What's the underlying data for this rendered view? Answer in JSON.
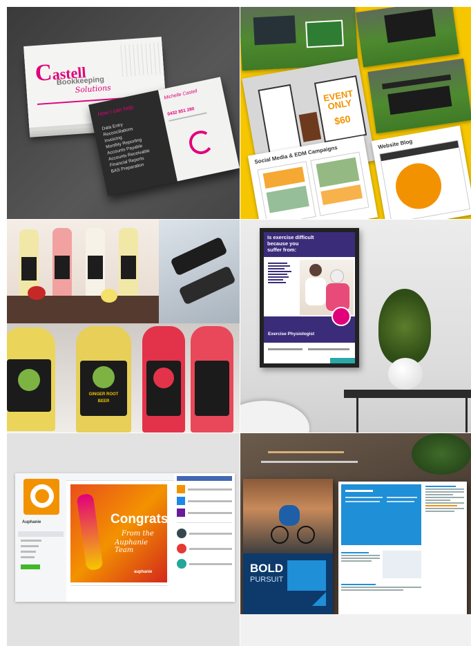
{
  "business_cards": {
    "brand_first": "C",
    "brand_rest": "astell",
    "brand_line2": "Bookkeeping",
    "brand_line3": "Solutions",
    "help_heading": "How I can help",
    "services": [
      "Data Entry",
      "Reconciliations",
      "Invoicing",
      "Monthly Reporting",
      "Accounts Payable",
      "Accounts Receivable",
      "Financial Reports",
      "BAS Preparation"
    ],
    "person": "Michelle Castell",
    "phone": "0432 851 280"
  },
  "event_collage": {
    "sign_line1": "EVENT",
    "sign_line2": "ONLY",
    "sign_price": "$60",
    "section_social": "Social Media & EDM Campaigns",
    "section_blog": "Website Blog"
  },
  "bottles": {
    "label_line1": "GINGER ROOT",
    "label_line2": "BEER"
  },
  "poster": {
    "headline_line1": "Is exercise difficult",
    "headline_line2": "because you",
    "headline_line3": "suffer from:",
    "footer": "Exercise Physiologist"
  },
  "facebook": {
    "page_name": "Auphanie",
    "congrats": "Congrats!",
    "from_line1": "From the",
    "from_line2": "Auphanie Team",
    "brand_watermark": "auphanie"
  },
  "brochure": {
    "logo_line1": "BOLD",
    "logo_line2": "PURSUIT"
  },
  "colors": {
    "magenta": "#e2007a",
    "yellow": "#f6c700",
    "orange": "#f39200",
    "purple": "#3b2c7a",
    "blue": "#1f8fd8",
    "navy": "#0d3a6b"
  }
}
